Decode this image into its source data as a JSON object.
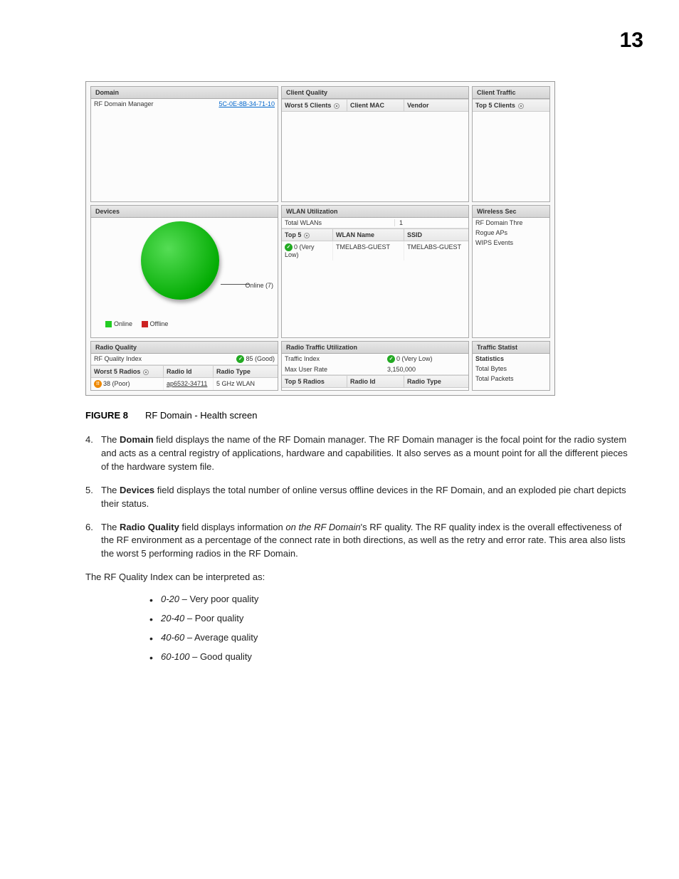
{
  "page_number": "13",
  "screenshot": {
    "domain": {
      "title": "Domain",
      "label": "RF Domain Manager",
      "value": "5C-0E-8B-34-71-10"
    },
    "client_quality": {
      "title": "Client Quality",
      "cols": {
        "c1": "Worst 5 Clients",
        "c2": "Client MAC",
        "c3": "Vendor"
      }
    },
    "client_traffic": {
      "title": "Client Traffic",
      "label": "Top 5 Clients"
    },
    "devices": {
      "title": "Devices",
      "pie_label": "Online (7)",
      "legend_online": "Online",
      "legend_offline": "Offline"
    },
    "wlan_util": {
      "title": "WLAN Utilization",
      "total_label": "Total WLANs",
      "total_value": "1",
      "cols": {
        "c1": "Top 5",
        "c2": "WLAN Name",
        "c3": "SSID"
      },
      "row": {
        "v1": "0 (Very Low)",
        "v2": "TMELABS-GUEST",
        "v3": "TMELABS-GUEST"
      }
    },
    "wireless_sec": {
      "title": "Wireless Sec",
      "items": [
        "RF Domain Thre",
        "Rogue APs",
        "WIPS Events"
      ]
    },
    "radio_quality": {
      "title": "Radio Quality",
      "idx_label": "RF Quality Index",
      "idx_value": "85 (Good)",
      "cols": {
        "c1": "Worst 5 Radios",
        "c2": "Radio Id",
        "c3": "Radio Type"
      },
      "row": {
        "v1": "38 (Poor)",
        "v2": "ap6532-34711",
        "v3": "5 GHz WLAN"
      }
    },
    "radio_traffic": {
      "title": "Radio Traffic Utilization",
      "ti_label": "Traffic Index",
      "ti_value": "0 (Very Low)",
      "mur_label": "Max User Rate",
      "mur_value": "3,150,000",
      "cols": {
        "c1": "Top 5 Radios",
        "c2": "Radio Id",
        "c3": "Radio Type"
      }
    },
    "traffic_stat": {
      "title": "Traffic Statist",
      "items": [
        "Statistics",
        "Total Bytes",
        "Total Packets"
      ]
    }
  },
  "figure": {
    "label": "FIGURE 8",
    "caption": "RF Domain - Health screen"
  },
  "paragraphs": {
    "p4": {
      "num": "4.",
      "pre": "The ",
      "bold": "Domain",
      "post": " field displays the name of the RF Domain manager. The RF Domain manager is the focal point for the radio system and acts as a central registry of applications, hardware and capabilities. It also serves as a mount point for all the different pieces of the hardware system file."
    },
    "p5": {
      "num": "5.",
      "pre": "The ",
      "bold": "Devices",
      "post": " field displays the total number of online versus offline devices in the RF Domain, and an exploded pie chart depicts their status."
    },
    "p6": {
      "num": "6.",
      "pre": "The ",
      "bold": "Radio Quality",
      "mid": " field displays information ",
      "italic": "on the RF Domain",
      "post": "'s RF quality. The RF quality index is the overall effectiveness of the RF environment as a percentage of the connect rate in both directions, as well as the retry and error rate. This area also lists the worst 5 performing radios in the RF Domain."
    },
    "intro": "The RF Quality Index can be interpreted as:",
    "bullets": [
      {
        "range": "0-20",
        "desc": " – Very poor quality"
      },
      {
        "range": "20-40",
        "desc": " – Poor quality"
      },
      {
        "range": "40-60",
        "desc": " – Average quality"
      },
      {
        "range": "60-100",
        "desc": " – Good quality"
      }
    ]
  },
  "chart_data": {
    "type": "pie",
    "title": "Devices",
    "categories": [
      "Online",
      "Offline"
    ],
    "values": [
      7,
      0
    ],
    "colors": [
      "#22cc22",
      "#cc2222"
    ]
  }
}
